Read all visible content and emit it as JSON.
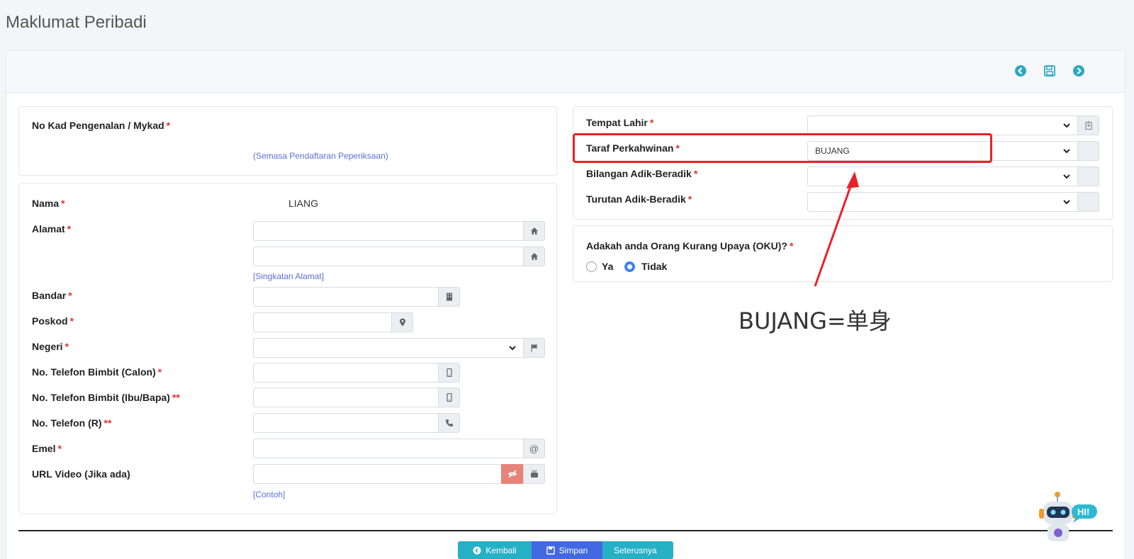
{
  "page": {
    "title": "Maklumat Peribadi"
  },
  "left_top": {
    "mykad_label": "No Kad Pengenalan / Mykad",
    "mykad_link": "(Semasa Pendaftaran Peperiksaan)"
  },
  "left": {
    "nama_label": "Nama",
    "nama_value": "LIANG",
    "alamat_label": "Alamat",
    "alamat_link": "[Singkatan Alamat]",
    "bandar_label": "Bandar",
    "poskod_label": "Poskod",
    "negeri_label": "Negeri",
    "tel_calon_label": "No. Telefon Bimbit (Calon)",
    "tel_ibubapa_label": "No. Telefon Bimbit (Ibu/Bapa)",
    "tel_ibubapa_req": "**",
    "tel_r_label": "No. Telefon (R)",
    "tel_r_req": "**",
    "emel_label": "Emel",
    "url_label": "URL Video (Jika ada)",
    "url_link": "[Contoh]",
    "required_mark": "*"
  },
  "right": {
    "tempat_lahir_label": "Tempat Lahir",
    "taraf_label": "Taraf Perkahwinan",
    "taraf_value": "BUJANG",
    "bilangan_label": "Bilangan Adik-Beradik",
    "turutan_label": "Turutan Adik-Beradik",
    "oku_question": "Adakah anda Orang Kurang Upaya (OKU)?",
    "oku_options": [
      "Ya",
      "Tidak"
    ],
    "oku_selected": "Tidak"
  },
  "annotation": {
    "text": "BUJANG=单身",
    "color": "#e8222a"
  },
  "buttons": {
    "back": "Kembali",
    "save": "Simpan",
    "next": "Seterusnya"
  },
  "mascot": {
    "text": "HI!"
  },
  "colors": {
    "accent": "#26b0c6",
    "primary": "#4169e1",
    "required": "#e3342f",
    "link": "#5b6fd6"
  }
}
